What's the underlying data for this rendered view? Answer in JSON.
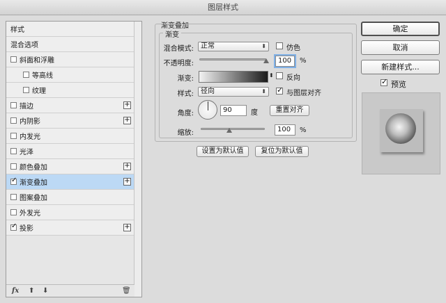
{
  "window": {
    "title": "图层样式"
  },
  "styles_list": {
    "items": [
      {
        "label": "样式",
        "checkbox": false,
        "checked": false,
        "plus": false,
        "indent": false,
        "selected": false
      },
      {
        "label": "混合选项",
        "checkbox": false,
        "checked": false,
        "plus": false,
        "indent": false,
        "selected": false
      },
      {
        "label": "斜面和浮雕",
        "checkbox": true,
        "checked": false,
        "plus": false,
        "indent": false,
        "selected": false
      },
      {
        "label": "等高线",
        "checkbox": true,
        "checked": false,
        "plus": false,
        "indent": true,
        "selected": false
      },
      {
        "label": "纹理",
        "checkbox": true,
        "checked": false,
        "plus": false,
        "indent": true,
        "selected": false
      },
      {
        "label": "描边",
        "checkbox": true,
        "checked": false,
        "plus": true,
        "indent": false,
        "selected": false
      },
      {
        "label": "内阴影",
        "checkbox": true,
        "checked": false,
        "plus": true,
        "indent": false,
        "selected": false
      },
      {
        "label": "内发光",
        "checkbox": true,
        "checked": false,
        "plus": false,
        "indent": false,
        "selected": false
      },
      {
        "label": "光泽",
        "checkbox": true,
        "checked": false,
        "plus": false,
        "indent": false,
        "selected": false
      },
      {
        "label": "颜色叠加",
        "checkbox": true,
        "checked": false,
        "plus": true,
        "indent": false,
        "selected": false
      },
      {
        "label": "渐变叠加",
        "checkbox": true,
        "checked": true,
        "plus": true,
        "indent": false,
        "selected": true
      },
      {
        "label": "图案叠加",
        "checkbox": true,
        "checked": false,
        "plus": false,
        "indent": false,
        "selected": false
      },
      {
        "label": "外发光",
        "checkbox": true,
        "checked": false,
        "plus": false,
        "indent": false,
        "selected": false
      },
      {
        "label": "投影",
        "checkbox": true,
        "checked": true,
        "plus": true,
        "indent": false,
        "selected": false
      }
    ],
    "footer": {
      "fx": "fx",
      "up": "⬆",
      "down": "⬇",
      "trash": "🗑"
    }
  },
  "gradient_overlay": {
    "title": "渐变叠加",
    "section": "渐变",
    "blend_mode_label": "混合模式:",
    "blend_mode": "正常",
    "dither_label": "仿色",
    "dither": false,
    "opacity_label": "不透明度:",
    "opacity": "100",
    "opacity_unit": "%",
    "opacity_level": 1.0,
    "gradient_label": "渐变:",
    "reverse_label": "反向",
    "reverse": false,
    "style_label": "样式:",
    "style": "径向",
    "align_label": "与图层对齐",
    "align": true,
    "angle_label": "角度:",
    "angle": "90",
    "angle_unit": "度",
    "reset_align": "重置对齐",
    "scale_label": "缩放:",
    "scale": "100",
    "scale_unit": "%",
    "scale_level": 0.45,
    "set_default": "设置为默认值",
    "reset_default": "复位为默认值"
  },
  "actions": {
    "ok": "确定",
    "cancel": "取消",
    "new_style": "新建样式...",
    "preview_label": "预览",
    "preview": true
  },
  "icons": {
    "plus": "+",
    "arrow": "⬍",
    "check": "✓"
  }
}
